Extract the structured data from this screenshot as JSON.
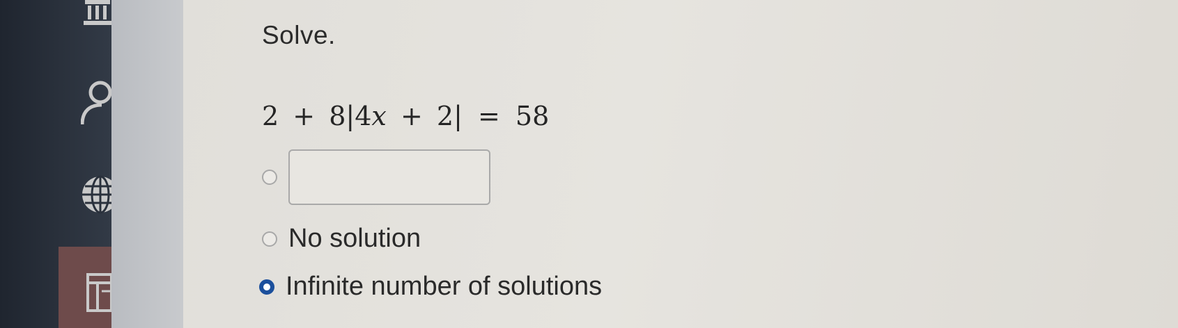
{
  "sidebar": {
    "icons": [
      "bank-icon",
      "user-icon",
      "globe-icon",
      "gradebook-icon"
    ],
    "active_color": "#6e4b4b"
  },
  "question": {
    "prompt": "Solve.",
    "equation": {
      "constant_left": "2",
      "plus1": "+",
      "coefficient": "8",
      "abs_open": "|",
      "inner_coeff": "4",
      "variable": "x",
      "plus2": "+",
      "inner_const": "2",
      "abs_close": "|",
      "equals": "=",
      "rhs": "58"
    }
  },
  "options": [
    {
      "type": "input",
      "value": "",
      "placeholder": "",
      "selected": false
    },
    {
      "type": "choice",
      "label": "No solution",
      "selected": false
    },
    {
      "type": "choice",
      "label": "Infinite number of solutions",
      "selected": true
    }
  ],
  "colors": {
    "selected_radio": "#1b4f9c",
    "text": "#2a2a2a"
  }
}
